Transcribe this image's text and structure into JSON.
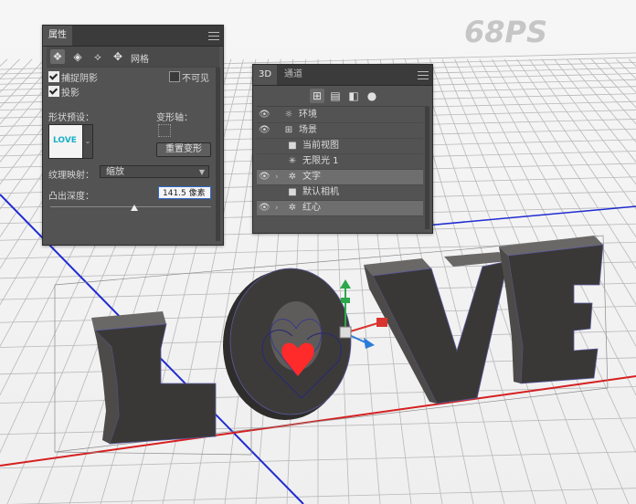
{
  "watermark": "68PS",
  "properties_panel": {
    "tab_title": "属性",
    "tab_close": "×",
    "toolbar_icons": [
      "mesh-icon",
      "deform-icon",
      "cap-icon",
      "coordinates-icon"
    ],
    "toolbar_label": "网格",
    "catch_shadows_label": "捕捉阴影",
    "cast_shadows_label": "投影",
    "invisible_label": "不可见",
    "shape_preset_label": "形状预设：",
    "shape_preset_thumb_text": "LOVE",
    "deform_axis_label": "变形轴：",
    "reset_deform_label": "重置变形",
    "texture_mapping_label": "纹理映射：",
    "texture_mapping_value": "缩放",
    "extrusion_depth_label": "凸出深度：",
    "extrusion_depth_value": "141.5 像素",
    "extrusion_slider": 0.52
  },
  "panel3d": {
    "tab_3d": "3D",
    "tab_channels": "通道",
    "filter_icons": [
      "scene-filter-icon",
      "mesh-filter-icon",
      "material-filter-icon",
      "light-filter-icon"
    ],
    "rows": [
      {
        "label": "环境",
        "eye": true,
        "twist": "",
        "indent": 0,
        "icon": "environment-icon",
        "glyph": "☼",
        "selected": false
      },
      {
        "label": "场景",
        "eye": true,
        "twist": "",
        "indent": 0,
        "icon": "scene-icon",
        "glyph": "⊞",
        "selected": false
      },
      {
        "label": "当前视图",
        "eye": false,
        "twist": "",
        "indent": 1,
        "icon": "camera-icon",
        "glyph": "■",
        "selected": false
      },
      {
        "label": "无限光 1",
        "eye": false,
        "twist": "",
        "indent": 1,
        "icon": "infinite-light-icon",
        "glyph": "✳",
        "selected": false
      },
      {
        "label": "文字",
        "eye": true,
        "twist": "›",
        "indent": 1,
        "icon": "mesh-icon",
        "glyph": "✲",
        "selected": true
      },
      {
        "label": "默认相机",
        "eye": false,
        "twist": "",
        "indent": 1,
        "icon": "camera-icon",
        "glyph": "■",
        "selected": false
      },
      {
        "label": "红心",
        "eye": true,
        "twist": "›",
        "indent": 1,
        "icon": "mesh-icon",
        "glyph": "✲",
        "selected": true
      }
    ]
  },
  "colors": {
    "grid_line": "#b9b9b9",
    "axis_red": "#d61f1f",
    "axis_blue": "#1f2bd1",
    "letter_face": "#3a3836",
    "letter_side": "#4a4846",
    "heart": "#ff2a2a",
    "panel_bg": "#535353",
    "highlight": "#6e6e6e"
  }
}
